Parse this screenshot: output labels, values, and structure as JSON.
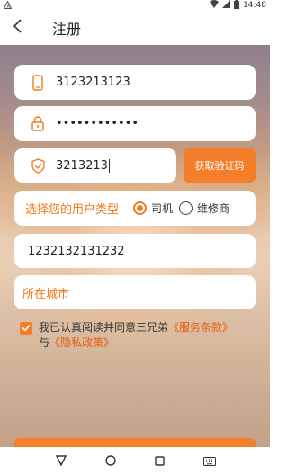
{
  "status_bar": {
    "time": "14:48"
  },
  "header": {
    "title": "注册"
  },
  "form": {
    "phone": "3123213123",
    "password": "••••••••••••",
    "verification_code": "3213213",
    "get_code_label": "获取验证码",
    "user_type_label": "选择您的用户类型",
    "user_type_options": [
      {
        "label": "司机",
        "checked": true
      },
      {
        "label": "维修商",
        "checked": false
      }
    ],
    "id_number": "1232132131232",
    "city_placeholder": "所在城市"
  },
  "agreement": {
    "checked": true,
    "text_before": "我已认真阅读并同意三兄弟",
    "terms_link": "《服务条款》",
    "text_and": "与",
    "privacy_link": "《隐私政策》"
  },
  "colors": {
    "accent": "#f57e2a",
    "link": "#e85b10"
  }
}
